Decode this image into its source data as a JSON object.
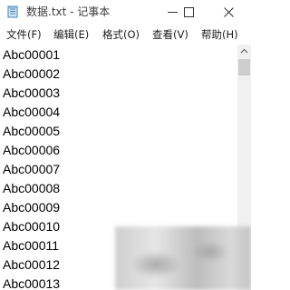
{
  "window": {
    "title": "数据.txt - 记事本",
    "app_icon": "notepad-icon",
    "controls": [
      "minimize-icon",
      "maximize-icon",
      "close-icon"
    ]
  },
  "menu": {
    "items": [
      "文件(F)",
      "编辑(E)",
      "格式(O)",
      "查看(V)",
      "帮助(H)"
    ]
  },
  "editor": {
    "lines": [
      "Abc00001",
      "Abc00002",
      "Abc00003",
      "Abc00004",
      "Abc00005",
      "Abc00006",
      "Abc00007",
      "Abc00008",
      "Abc00009",
      "Abc00010",
      "Abc00011",
      "Abc00012",
      "Abc00013"
    ]
  },
  "scrollbar": {
    "icons": [
      "scroll-up-arrow-icon"
    ]
  },
  "colors": {
    "background": "#ffffff",
    "text": "#000000",
    "scrollbar_track": "#f0f0f0",
    "scrollbar_thumb": "#cdcdcd"
  }
}
